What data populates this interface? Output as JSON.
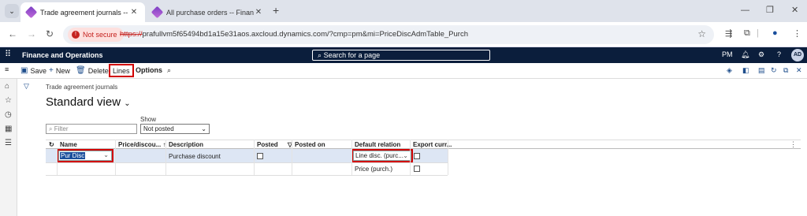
{
  "browser": {
    "tabs": [
      {
        "title": "Trade agreement journals -- Fin",
        "active": true
      },
      {
        "title": "All purchase orders -- Finance a",
        "active": false
      }
    ],
    "new_tab": "+",
    "security_label": "Not secure",
    "url_protocol": "https://",
    "url_rest": "prafullvm5f65494bd1a15e31aos.axcloud.dynamics.com/?cmp=pm&mi=PriceDiscAdmTable_Purch"
  },
  "header": {
    "app_name": "Finance and Operations",
    "search_placeholder": "Search for a page",
    "company": "PM",
    "avatar_initials": "AD"
  },
  "actions": {
    "save": "Save",
    "new": "New",
    "delete": "Delete",
    "lines": "Lines",
    "options": "Options"
  },
  "page": {
    "breadcrumb": "Trade agreement journals",
    "view_title": "Standard view",
    "filter_placeholder": "Filter",
    "show_label": "Show",
    "show_value": "Not posted"
  },
  "grid": {
    "columns": [
      "Name",
      "Price/discou...",
      "Description",
      "Posted",
      "Posted on",
      "Default relation",
      "Export curr..."
    ],
    "rows": [
      {
        "name": "Pur Disc",
        "description": "Purchase discount",
        "default_relation": "Line disc. (purc..."
      },
      {
        "name": "",
        "description": "",
        "default_relation": "Price (purch.)"
      }
    ]
  },
  "colors": {
    "header_bg": "#0b1e3c",
    "accent": "#1e4e8c",
    "highlight": "#d10000",
    "selected_row": "#dde6f4"
  }
}
